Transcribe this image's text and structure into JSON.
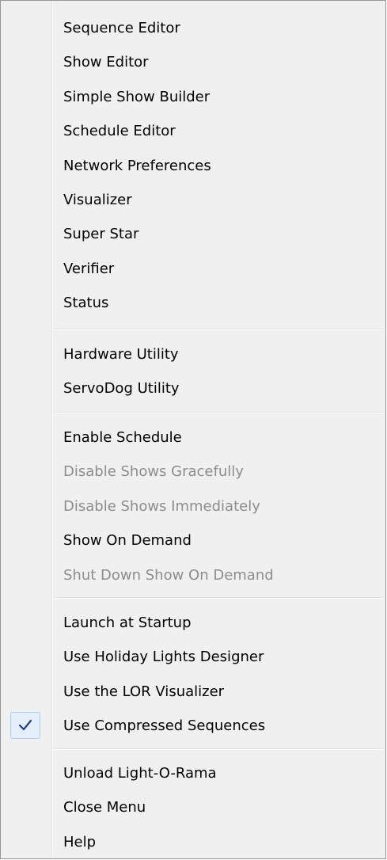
{
  "menu": {
    "groups": [
      {
        "items": [
          {
            "label": "Sequence Editor"
          },
          {
            "label": "Show Editor"
          },
          {
            "label": "Simple Show Builder"
          },
          {
            "label": "Schedule Editor"
          },
          {
            "label": "Network Preferences"
          },
          {
            "label": "Visualizer"
          },
          {
            "label": "Super Star"
          },
          {
            "label": "Verifier"
          },
          {
            "label": "Status"
          }
        ]
      },
      {
        "items": [
          {
            "label": "Hardware Utility"
          },
          {
            "label": "ServoDog Utility"
          }
        ]
      },
      {
        "items": [
          {
            "label": "Enable Schedule"
          },
          {
            "label": "Disable Shows Gracefully",
            "disabled": true
          },
          {
            "label": "Disable Shows Immediately",
            "disabled": true
          },
          {
            "label": "Show On Demand"
          },
          {
            "label": "Shut Down Show On Demand",
            "disabled": true
          }
        ]
      },
      {
        "items": [
          {
            "label": "Launch at Startup"
          },
          {
            "label": "Use Holiday Lights Designer"
          },
          {
            "label": "Use the LOR Visualizer"
          },
          {
            "label": "Use Compressed Sequences",
            "checked": true
          }
        ]
      },
      {
        "items": [
          {
            "label": "Unload Light-O-Rama"
          },
          {
            "label": "Close Menu"
          },
          {
            "label": "Help"
          }
        ]
      }
    ]
  },
  "colors": {
    "menu_background": "#f0f0f0",
    "text": "#000000",
    "disabled_text": "#8d8d8d",
    "check_highlight": "#e5eefb",
    "check_mark": "#1f3f8f"
  },
  "icons": {
    "checked_indicator": "checkmark-icon"
  }
}
